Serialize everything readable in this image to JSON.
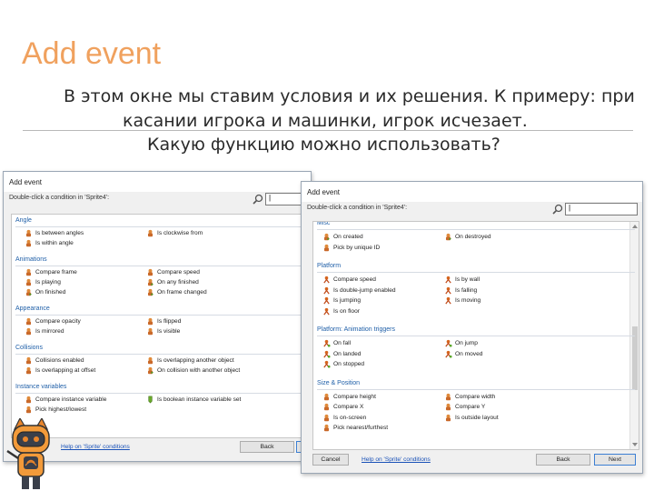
{
  "slide": {
    "title": "Add event",
    "text_line1": "В этом окне мы ставим условия и их решения. К примеру: при",
    "text_line2": "касании игрока и машинки, игрок исчезает.",
    "text_line3": "Какую функцию можно использовать?"
  },
  "colors": {
    "title": "#f0a15e",
    "group_header": "#1f5fa8",
    "link": "#1a52b8"
  },
  "window1": {
    "title": "Add event",
    "prompt": "Double-click a condition in 'Sprite4':",
    "search_value": "",
    "groups": [
      {
        "name": "Angle",
        "items": [
          {
            "label": "Is between angles",
            "icon": "sprite-condition-icon"
          },
          {
            "label": "Is clockwise from",
            "icon": "sprite-condition-icon"
          },
          {
            "label": "Is within angle",
            "icon": "sprite-condition-icon"
          }
        ]
      },
      {
        "name": "Animations",
        "items": [
          {
            "label": "Compare frame",
            "icon": "sprite-condition-icon"
          },
          {
            "label": "Compare speed",
            "icon": "sprite-condition-icon"
          },
          {
            "label": "Is playing",
            "icon": "sprite-condition-icon"
          },
          {
            "label": "On any finished",
            "icon": "trigger-icon"
          },
          {
            "label": "On finished",
            "icon": "trigger-icon"
          },
          {
            "label": "On frame changed",
            "icon": "trigger-icon"
          }
        ]
      },
      {
        "name": "Appearance",
        "items": [
          {
            "label": "Compare opacity",
            "icon": "sprite-condition-icon"
          },
          {
            "label": "Is flipped",
            "icon": "sprite-condition-icon"
          },
          {
            "label": "Is mirrored",
            "icon": "sprite-condition-icon"
          },
          {
            "label": "Is visible",
            "icon": "sprite-condition-icon"
          }
        ]
      },
      {
        "name": "Collisions",
        "items": [
          {
            "label": "Collisions enabled",
            "icon": "sprite-condition-icon"
          },
          {
            "label": "Is overlapping another object",
            "icon": "sprite-condition-icon"
          },
          {
            "label": "Is overlapping at offset",
            "icon": "sprite-condition-icon"
          },
          {
            "label": "On collision with another object",
            "icon": "trigger-icon"
          }
        ]
      },
      {
        "name": "Instance variables",
        "items": [
          {
            "label": "Compare instance variable",
            "icon": "sprite-condition-icon"
          },
          {
            "label": "Is boolean instance variable set",
            "icon": "boolean-icon"
          },
          {
            "label": "Pick highest/lowest",
            "icon": "sprite-condition-icon"
          }
        ]
      }
    ],
    "help_link": "Help on 'Sprite' conditions",
    "back_label": "Back"
  },
  "window2": {
    "title": "Add event",
    "prompt": "Double-click a condition in 'Sprite4':",
    "search_value": "",
    "groups": [
      {
        "name": "Misc",
        "items": [
          {
            "label": "On created",
            "icon": "trigger-icon"
          },
          {
            "label": "On destroyed",
            "icon": "trigger-icon"
          },
          {
            "label": "Pick by unique ID",
            "icon": "sprite-condition-icon"
          }
        ]
      },
      {
        "name": "Platform",
        "items": [
          {
            "label": "Compare speed",
            "icon": "platform-icon"
          },
          {
            "label": "Is by wall",
            "icon": "platform-icon"
          },
          {
            "label": "Is double-jump enabled",
            "icon": "platform-icon"
          },
          {
            "label": "Is falling",
            "icon": "platform-icon"
          },
          {
            "label": "Is jumping",
            "icon": "platform-icon"
          },
          {
            "label": "Is moving",
            "icon": "platform-icon"
          },
          {
            "label": "Is on floor",
            "icon": "platform-icon"
          }
        ]
      },
      {
        "name": "Platform: Animation triggers",
        "items": [
          {
            "label": "On fall",
            "icon": "platform-trigger-icon"
          },
          {
            "label": "On jump",
            "icon": "platform-trigger-icon"
          },
          {
            "label": "On landed",
            "icon": "platform-trigger-icon"
          },
          {
            "label": "On moved",
            "icon": "platform-trigger-icon"
          },
          {
            "label": "On stopped",
            "icon": "platform-trigger-icon"
          }
        ]
      },
      {
        "name": "Size & Position",
        "items": [
          {
            "label": "Compare height",
            "icon": "sprite-condition-icon"
          },
          {
            "label": "Compare width",
            "icon": "sprite-condition-icon"
          },
          {
            "label": "Compare X",
            "icon": "sprite-condition-icon"
          },
          {
            "label": "Compare Y",
            "icon": "sprite-condition-icon"
          },
          {
            "label": "Is on-screen",
            "icon": "sprite-condition-icon"
          },
          {
            "label": "Is outside layout",
            "icon": "sprite-condition-icon"
          },
          {
            "label": "Pick nearest/furthest",
            "icon": "sprite-condition-icon"
          }
        ]
      }
    ],
    "cancel_label": "Cancel",
    "help_link": "Help on 'Sprite' conditions",
    "back_label": "Back",
    "next_label": "Next"
  }
}
